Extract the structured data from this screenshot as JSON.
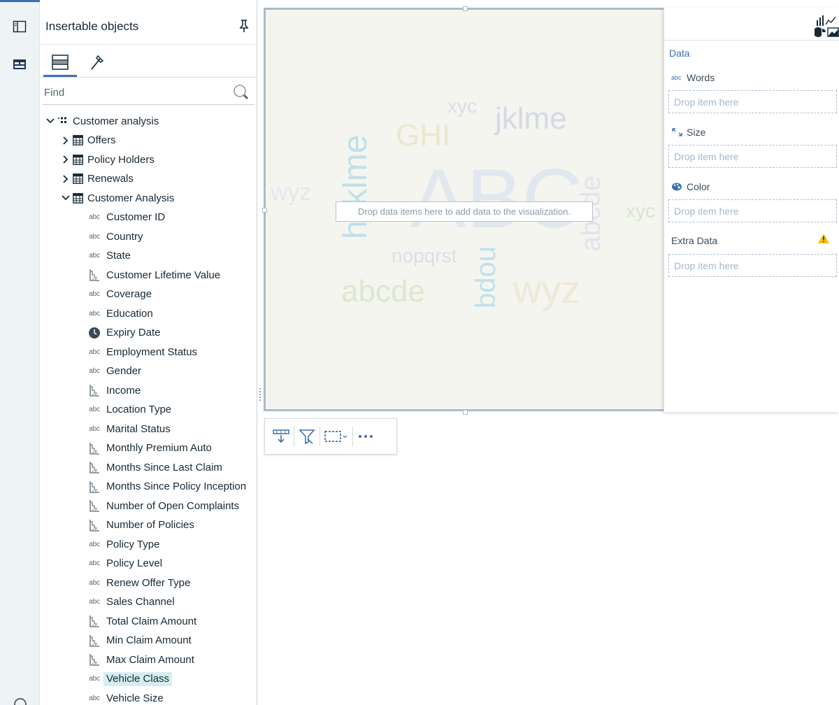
{
  "panel": {
    "title": "Insertable objects",
    "find_placeholder": "Find"
  },
  "tree": [
    {
      "label": "Customer analysis",
      "type": "source",
      "caret": "down"
    },
    {
      "label": "Offers",
      "type": "table",
      "caret": "right"
    },
    {
      "label": "Policy Holders",
      "type": "table",
      "caret": "right"
    },
    {
      "label": "Renewals",
      "type": "table",
      "caret": "right"
    },
    {
      "label": "Customer Analysis",
      "type": "table",
      "caret": "down"
    },
    {
      "label": "Customer ID",
      "type": "abc"
    },
    {
      "label": "Country",
      "type": "abc"
    },
    {
      "label": "State",
      "type": "abc"
    },
    {
      "label": "Customer Lifetime Value",
      "type": "measure"
    },
    {
      "label": "Coverage",
      "type": "abc"
    },
    {
      "label": "Education",
      "type": "abc"
    },
    {
      "label": "Expiry Date",
      "type": "date"
    },
    {
      "label": "Employment Status",
      "type": "abc"
    },
    {
      "label": "Gender",
      "type": "abc"
    },
    {
      "label": "Income",
      "type": "measure"
    },
    {
      "label": "Location Type",
      "type": "abc"
    },
    {
      "label": "Marital Status",
      "type": "abc"
    },
    {
      "label": "Monthly Premium Auto",
      "type": "measure"
    },
    {
      "label": "Months Since Last Claim",
      "type": "measure"
    },
    {
      "label": "Months Since Policy Inception",
      "type": "measure"
    },
    {
      "label": "Number of Open Complaints",
      "type": "measure"
    },
    {
      "label": "Number of Policies",
      "type": "measure"
    },
    {
      "label": "Policy Type",
      "type": "abc"
    },
    {
      "label": "Policy Level",
      "type": "abc"
    },
    {
      "label": "Renew Offer  Type",
      "type": "abc"
    },
    {
      "label": "Sales Channel",
      "type": "abc"
    },
    {
      "label": "Total Claim Amount",
      "type": "measure"
    },
    {
      "label": "Min Claim Amount",
      "type": "measure"
    },
    {
      "label": "Max Claim Amount",
      "type": "measure"
    },
    {
      "label": "Vehicle Class",
      "type": "abc",
      "selected": true
    },
    {
      "label": "Vehicle Size",
      "type": "abc"
    }
  ],
  "abc_badge": "abc",
  "canvas": {
    "drop_hint": "Drop data items here to add data to the visualization.",
    "words": [
      "ABC",
      "jklme",
      "GHI",
      "xyc",
      "wyz",
      "hijklme",
      "abcde",
      "xyc",
      "nopqrst",
      "abcde",
      "nopq",
      "wyz"
    ]
  },
  "slots": {
    "section": "Data",
    "words_label": "Words",
    "size_label": "Size",
    "color_label": "Color",
    "extra_label": "Extra Data",
    "drop_text": "Drop item here"
  },
  "colors": {
    "accent": "#3d70b2",
    "selected_bg": "#d4eef0",
    "canvas_bg": "#f5f5ef",
    "warning": "#efc100"
  }
}
